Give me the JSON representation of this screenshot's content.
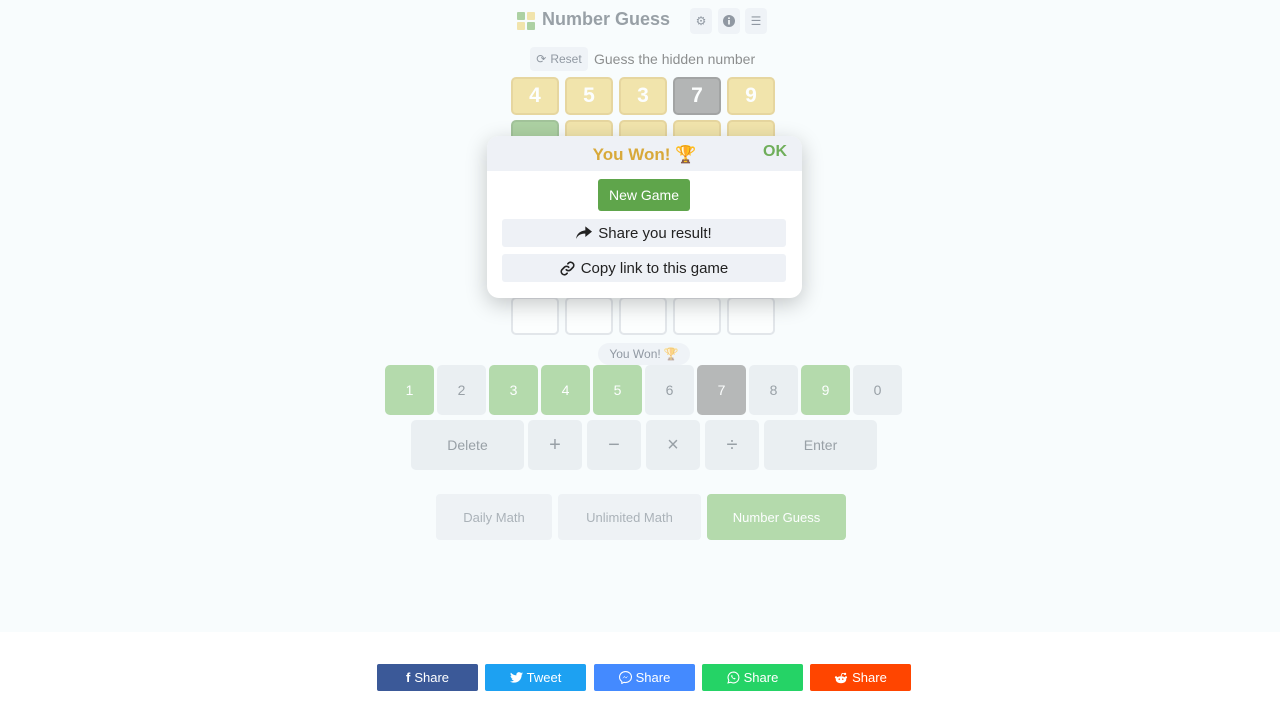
{
  "header": {
    "title": "Number Guess",
    "settings_icon": "gear-icon",
    "info_icon": "info-icon",
    "menu_icon": "menu-icon",
    "logo_colors": [
      "#6fae5a",
      "#eccf6a",
      "#eccf6a",
      "#6fae5a"
    ]
  },
  "toolbar": {
    "reset_label": "Reset",
    "reset_icon": "refresh-icon",
    "subtitle": "Guess the hidden number"
  },
  "board": {
    "row1": [
      {
        "value": "4",
        "state": "yellow"
      },
      {
        "value": "5",
        "state": "yellow"
      },
      {
        "value": "3",
        "state": "yellow"
      },
      {
        "value": "7",
        "state": "gray"
      },
      {
        "value": "9",
        "state": "yellow"
      }
    ],
    "row2_states": [
      "green",
      "yellow",
      "yellow",
      "yellow",
      "yellow"
    ],
    "empty_row_count": 5
  },
  "status_badge": {
    "text": "You Won!",
    "icon": "trophy-icon"
  },
  "keypad": {
    "digits": [
      {
        "label": "1",
        "state": "green"
      },
      {
        "label": "2",
        "state": "light"
      },
      {
        "label": "3",
        "state": "green"
      },
      {
        "label": "4",
        "state": "green"
      },
      {
        "label": "5",
        "state": "green"
      },
      {
        "label": "6",
        "state": "light"
      },
      {
        "label": "7",
        "state": "gray"
      },
      {
        "label": "8",
        "state": "light"
      },
      {
        "label": "9",
        "state": "green"
      },
      {
        "label": "0",
        "state": "light"
      }
    ],
    "delete_label": "Delete",
    "enter_label": "Enter",
    "operators": [
      "+",
      "−",
      "×",
      "÷"
    ]
  },
  "modes": [
    {
      "label": "Daily Math",
      "active": false
    },
    {
      "label": "Unlimited Math",
      "active": false
    },
    {
      "label": "Number Guess",
      "active": true
    }
  ],
  "modal": {
    "title": "You Won!",
    "title_icon": "trophy-icon",
    "ok_label": "OK",
    "new_game_label": "New Game",
    "share_result_label": "Share you result!",
    "share_icon": "share-arrow-icon",
    "copy_link_label": "Copy link to this game",
    "link_icon": "link-icon"
  },
  "share_bar": [
    {
      "label": "Share",
      "icon": "facebook-icon",
      "color": "#3b5998"
    },
    {
      "label": "Tweet",
      "icon": "twitter-icon",
      "color": "#1da1f2"
    },
    {
      "label": "Share",
      "icon": "messenger-icon",
      "color": "#448aff"
    },
    {
      "label": "Share",
      "icon": "whatsapp-icon",
      "color": "#25d366"
    },
    {
      "label": "Share",
      "icon": "reddit-icon",
      "color": "#ff4500"
    }
  ]
}
